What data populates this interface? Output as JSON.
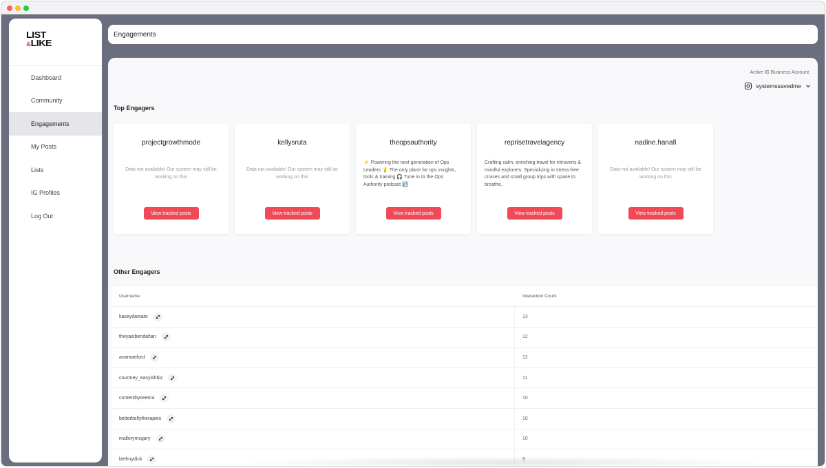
{
  "sidebar": {
    "logo_line1": "LIST",
    "logo_amp": "&",
    "logo_line2": "LIKE",
    "items": [
      {
        "label": "Dashboard"
      },
      {
        "label": "Community"
      },
      {
        "label": "Engagements"
      },
      {
        "label": "My Posts"
      },
      {
        "label": "Lists"
      },
      {
        "label": "IG Profiles"
      },
      {
        "label": "Log Out"
      }
    ]
  },
  "header": {
    "title": "Engagements"
  },
  "account": {
    "label": "Active IG Business Account:",
    "name": "systemssavedme"
  },
  "top_engagers": {
    "title": "Top Engagers",
    "button_label": "View tracked posts",
    "cards": [
      {
        "name": "projectgrowthmode",
        "bio": "Data not available! Our system may still be working on this"
      },
      {
        "name": "kellysruta",
        "bio": "Data not available! Our system may still be working on this"
      },
      {
        "name": "theopsauthority",
        "bio": "⚡️ Powering the next generation of Ops Leaders 💡 The only place for ops insights, tools & training 🎧 Tune in to the Ops Authority podcast ⤵️"
      },
      {
        "name": "reprisetravelagency",
        "bio": "Crafting calm, enriching travel for introverts & mindful explorers. Specializing in stress-free cruises and small group trips with space to breathe."
      },
      {
        "name": "nadine.hanafi",
        "bio": "Data not available! Our system may still be working on this"
      }
    ]
  },
  "other_engagers": {
    "title": "Other Engagers",
    "col_username": "Username",
    "col_count": "Interaction Count",
    "rows": [
      {
        "username": "kaseydamato",
        "count": "13"
      },
      {
        "username": "theyaelbendahan",
        "count": "12"
      },
      {
        "username": "anamaeford",
        "count": "12"
      },
      {
        "username": "courtney_easyishbiz",
        "count": "11"
      },
      {
        "username": "contentbyseema",
        "count": "10"
      },
      {
        "username": "betterbellytherapies",
        "count": "10"
      },
      {
        "username": "mallorymcgary",
        "count": "10"
      },
      {
        "username": "bethnydick",
        "count": "9"
      }
    ]
  },
  "colors": {
    "accent": "#ef4a56",
    "window_bg": "#6b6e7e",
    "active_nav": "#e6e6ea"
  }
}
